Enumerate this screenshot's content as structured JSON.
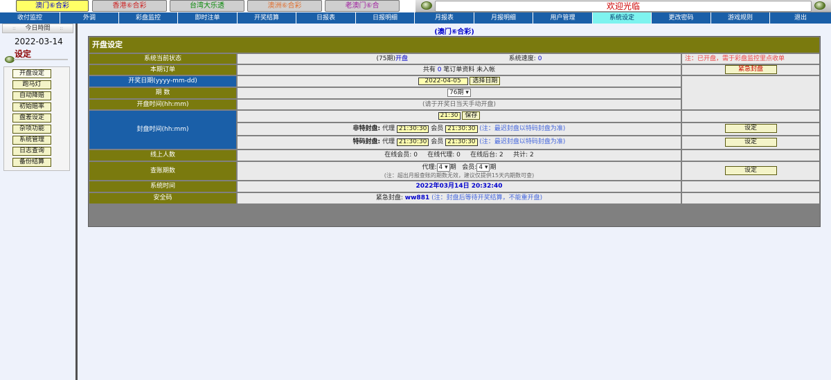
{
  "top_tabs": [
    {
      "label": "澳门⑥合彩",
      "color": "#0000cc"
    },
    {
      "label": "香港⑥合彩",
      "color": "#cc2222"
    },
    {
      "label": "台湾大乐透",
      "color": "#0b8a0b"
    },
    {
      "label": "澳洲⑥合彩",
      "color": "#e07030"
    },
    {
      "label": "老澳门⑥合",
      "color": "#a020a0"
    }
  ],
  "welcome": "欢迎光临",
  "nav": [
    "收付监控",
    "外调",
    "彩盘监控",
    "即时注单",
    "开奖结算",
    "日报表",
    "日报明细",
    "月报表",
    "月报明细",
    "用户管理",
    "系统设定",
    "更改密码",
    "游戏规则",
    "退出"
  ],
  "sidebar": {
    "today_label": "今日時間",
    "dots": "::",
    "date": "2022-03-14",
    "title": "设定",
    "menu": [
      "开盘设定",
      "跑马灯",
      "自动降赔",
      "初始赔率",
      "盘差设定",
      "杂项功能",
      "系统管理",
      "日志查询",
      "备份结算"
    ]
  },
  "page_subtitle": "(澳门⑥合彩)",
  "panel": {
    "title": "开盘设定",
    "status_label": "系统当前状态",
    "status_period": "(75期)",
    "status_open": "开盘",
    "speed_label": "系统速度:",
    "speed_value": "0",
    "status_note": "注：已开盘，需于彩盘监控里点收单",
    "order_label": "本期订单",
    "order_pre": "共有",
    "order_count": "0",
    "order_post": "笔订单资料 未入帐",
    "emergency_btn": "紧急封盘",
    "draw_date_label": "开奖日期(yyyy-mm-dd)",
    "draw_date_value": "2022-04-05",
    "choose_date_btn": "选择日期",
    "period_label": "期 数",
    "period_value": "76期",
    "open_time_label": "开盘时间(hh:mm)",
    "open_time_note": "(请于开奖日当天手动开盘)",
    "close_time_label": "封盘时间(hh:mm)",
    "close_time_value": "21:30",
    "save_btn": "保存",
    "non_special_label": "非特封盘:",
    "special_label": "特码封盘:",
    "agent_label": "代理",
    "member_label": "会员",
    "agent_time": "21:30:30",
    "member_time": "21:30:30",
    "close_note": "(注：最迟封盘以特码封盘为准)",
    "set_btn": "设定",
    "online_label": "线上人数",
    "online_text": "在线会员: 0     在线代理: 0     在线后台: 2     共计: 2",
    "query_label": "查账期数",
    "query_agent": "代理:",
    "query_agent_value": "4",
    "query_member": "会员:",
    "query_member_value": "4",
    "period_unit": "期",
    "query_note": "(注：超出月报查账的期数无效，建议仅提供15天内期数可查)",
    "sys_time_label": "系统时间",
    "sys_time_value": "2022年03月14日 20:32:40",
    "security_label": "安全码",
    "security_pre": "紧急封盘:",
    "security_code": "ww881",
    "security_note": "(注：封盘后等待开奖结算，不能重开盘)"
  }
}
